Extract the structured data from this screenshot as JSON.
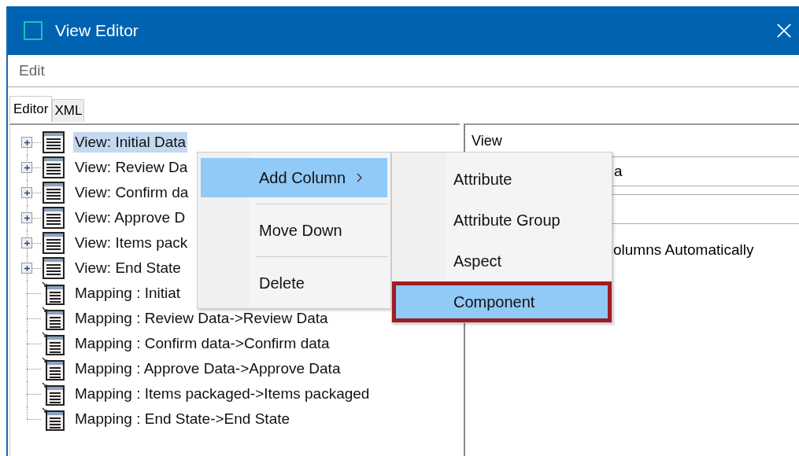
{
  "window": {
    "title": "View Editor"
  },
  "menu_bar": [
    "Edit"
  ],
  "tabs": [
    {
      "label": "Editor",
      "selected": true
    },
    {
      "label": "XML",
      "selected": false
    }
  ],
  "tree": [
    {
      "kind": "view",
      "label": "View: Initial Data",
      "selected": true
    },
    {
      "kind": "view",
      "label": "View: Review Da",
      "selected": false
    },
    {
      "kind": "view",
      "label": "View: Confirm da",
      "selected": false
    },
    {
      "kind": "view",
      "label": "View: Approve D",
      "selected": false
    },
    {
      "kind": "view",
      "label": "View: Items pack",
      "selected": false
    },
    {
      "kind": "view",
      "label": "View: End State",
      "selected": false
    },
    {
      "kind": "mapping",
      "label": "Mapping : Initiat",
      "selected": false
    },
    {
      "kind": "mapping",
      "label": "Mapping : Review Data->Review Data",
      "selected": false
    },
    {
      "kind": "mapping",
      "label": "Mapping : Confirm data->Confirm data",
      "selected": false
    },
    {
      "kind": "mapping",
      "label": "Mapping : Approve Data->Approve Data",
      "selected": false
    },
    {
      "kind": "mapping",
      "label": "Mapping : Items packaged->Items packaged",
      "selected": false
    },
    {
      "kind": "mapping",
      "label": "Mapping : End State->End State",
      "selected": false
    }
  ],
  "details": {
    "section_label": "View",
    "name_field": {
      "value": "a"
    },
    "checkbox_label": "olumns Automatically"
  },
  "context_menu": {
    "items": [
      {
        "label": "Add Column",
        "submenu": true,
        "selected": true
      },
      {
        "label": "Move Down",
        "submenu": false,
        "selected": false
      },
      {
        "label": "Delete",
        "submenu": false,
        "selected": false
      }
    ]
  },
  "submenu": {
    "items": [
      {
        "label": "Attribute",
        "selected": false
      },
      {
        "label": "Attribute Group",
        "selected": false
      },
      {
        "label": "Aspect",
        "selected": false
      },
      {
        "label": "Component",
        "selected": true
      }
    ]
  }
}
